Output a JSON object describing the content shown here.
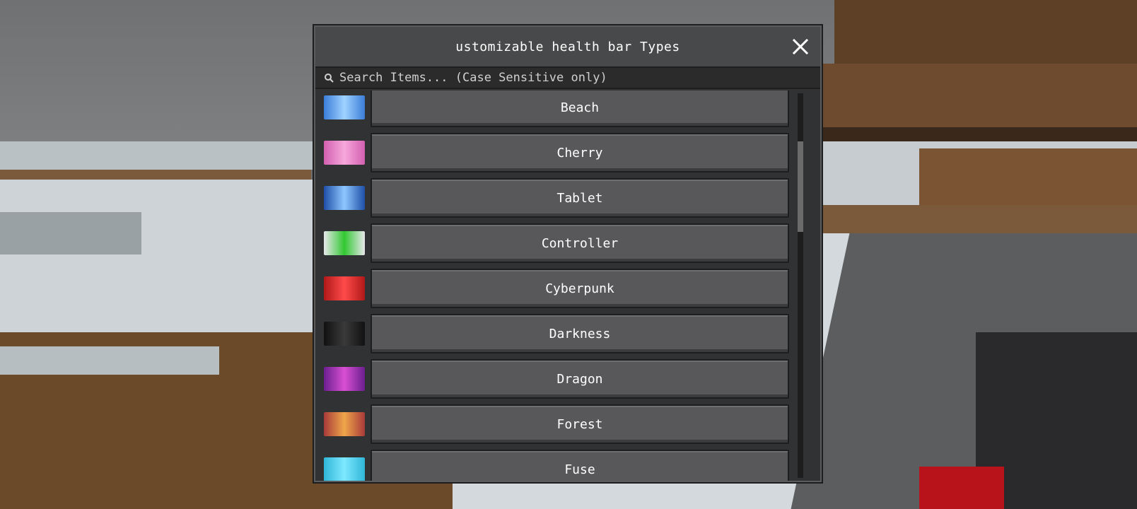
{
  "dialog": {
    "title": "ustomizable health bar  Types",
    "close_icon": "close-icon",
    "search": {
      "icon": "search-icon",
      "placeholder": "Search Items... (Case Sensitive only)",
      "value": ""
    },
    "items": [
      {
        "label": "Beach",
        "thumb_color": "#3b7dd8",
        "thumb_accent": "#9fd2ff"
      },
      {
        "label": "Cherry",
        "thumb_color": "#d35fb0",
        "thumb_accent": "#f7a8dc"
      },
      {
        "label": "Tablet",
        "thumb_color": "#1f4fa8",
        "thumb_accent": "#8ec7ff"
      },
      {
        "label": "Controller",
        "thumb_color": "#e8e8ec",
        "thumb_accent": "#32c832"
      },
      {
        "label": "Cyberpunk",
        "thumb_color": "#b01818",
        "thumb_accent": "#ff4a4a"
      },
      {
        "label": "Darkness",
        "thumb_color": "#111111",
        "thumb_accent": "#3a3a3a"
      },
      {
        "label": "Dragon",
        "thumb_color": "#6a1f8f",
        "thumb_accent": "#d94fd4"
      },
      {
        "label": "Forest",
        "thumb_color": "#a83a3a",
        "thumb_accent": "#f0a64a"
      },
      {
        "label": "Fuse",
        "thumb_color": "#2fb6d8",
        "thumb_accent": "#7ee8ff"
      }
    ],
    "scrollbar": {
      "position_fraction": 0.13
    }
  },
  "colors": {
    "panel": "#313233",
    "button": "#58585a",
    "text": "#ffffff"
  }
}
